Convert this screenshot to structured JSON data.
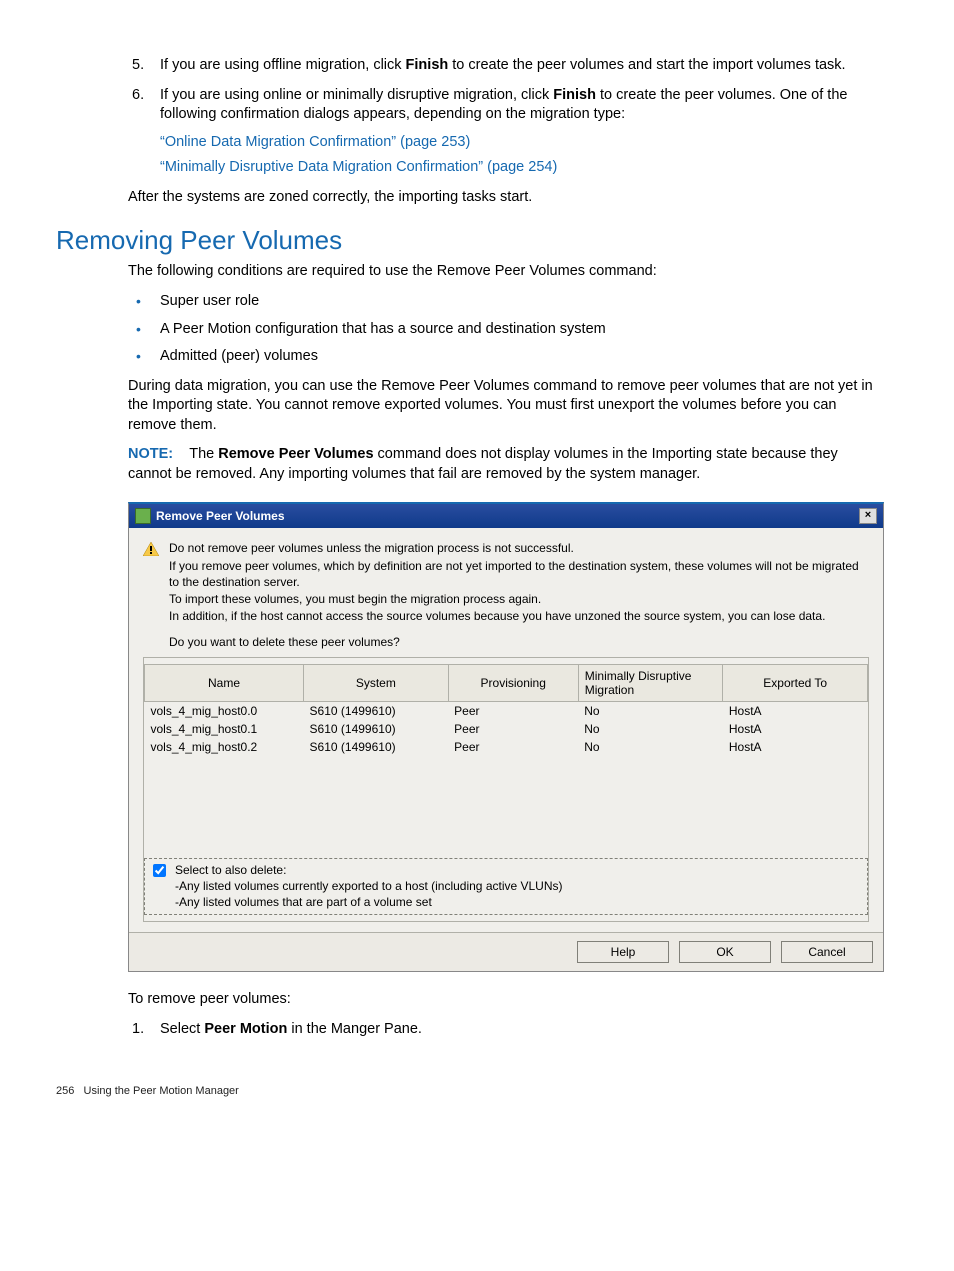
{
  "list_item_5_a": "If you are using offline migration, click ",
  "list_item_5_finish": "Finish",
  "list_item_5_b": " to create the peer volumes and start the import volumes task.",
  "list_item_6_a": "If you are using online or minimally disruptive migration, click ",
  "list_item_6_finish": "Finish",
  "list_item_6_b": " to create the peer volumes. One of the following confirmation dialogs appears, depending on the migration type:",
  "link_online": "“Online Data Migration Confirmation” (page 253)",
  "link_min": "“Minimally Disruptive Data Migration Confirmation” (page 254)",
  "after_zoned": "After the systems are zoned correctly, the importing tasks start.",
  "heading": "Removing Peer Volumes",
  "conditions_intro": "The following conditions are required to use the Remove Peer Volumes command:",
  "bullets": [
    "Super user role",
    "A Peer Motion configuration that has a source and destination system",
    "Admitted (peer) volumes"
  ],
  "during_para": "During data migration, you can use the Remove Peer Volumes command to remove peer volumes that are not yet in the Importing state. You cannot remove exported volumes. You must first unexport the volumes before you can remove them.",
  "note_label": "NOTE:",
  "note_pre": "The ",
  "note_bold": "Remove Peer Volumes",
  "note_post": " command does not display volumes in the Importing state because they cannot be removed. Any importing volumes that fail are removed by the system manager.",
  "dialog": {
    "title": "Remove Peer Volumes",
    "warn_lines": [
      "Do not remove peer volumes unless the migration process is not successful.",
      "If you remove peer volumes, which by definition are not yet imported to the destination system, these volumes will not be migrated to the destination server.",
      "To import these volumes, you must begin the migration process again.",
      "In addition, if the host cannot access the source volumes because you have unzoned the source system, you can lose data."
    ],
    "question": "Do you want to delete these peer volumes?",
    "columns": [
      "Name",
      "System",
      "Provisioning",
      "Minimally Disruptive Migration",
      "Exported To"
    ],
    "rows": [
      {
        "name": "vols_4_mig_host0.0",
        "system": "S610 (1499610)",
        "prov": "Peer",
        "mdm": "No",
        "exp": "HostA"
      },
      {
        "name": "vols_4_mig_host0.1",
        "system": "S610 (1499610)",
        "prov": "Peer",
        "mdm": "No",
        "exp": "HostA"
      },
      {
        "name": "vols_4_mig_host0.2",
        "system": "S610 (1499610)",
        "prov": "Peer",
        "mdm": "No",
        "exp": "HostA"
      }
    ],
    "select_also_label": "Select to also delete:",
    "select_also_line1": "-Any listed volumes currently exported to a host (including active VLUNs)",
    "select_also_line2": "-Any listed volumes that are part of a volume set",
    "buttons": {
      "help": "Help",
      "ok": "OK",
      "cancel": "Cancel"
    }
  },
  "to_remove": "To remove peer volumes:",
  "step1_a": "Select ",
  "step1_b": "Peer Motion",
  "step1_c": " in the Manger Pane.",
  "footer_page": "256",
  "footer_text": "Using the Peer Motion Manager"
}
